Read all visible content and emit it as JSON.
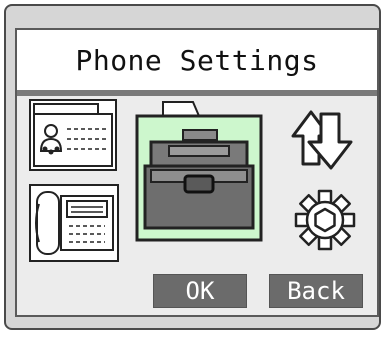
{
  "title": "Phone Settings",
  "icons": {
    "items": [
      {
        "name": "desk-phone-speaker"
      },
      {
        "name": "handset-phone"
      },
      {
        "name": "toolbox",
        "selected": true
      },
      {
        "name": "transfer-arrows"
      },
      {
        "name": "settings-gear"
      }
    ]
  },
  "buttons": {
    "ok": "OK",
    "back": "Back"
  },
  "colors": {
    "selected_highlight": "#cdf7cd",
    "button_bg": "#6b6b6b",
    "divider": "#7a7a7a"
  }
}
